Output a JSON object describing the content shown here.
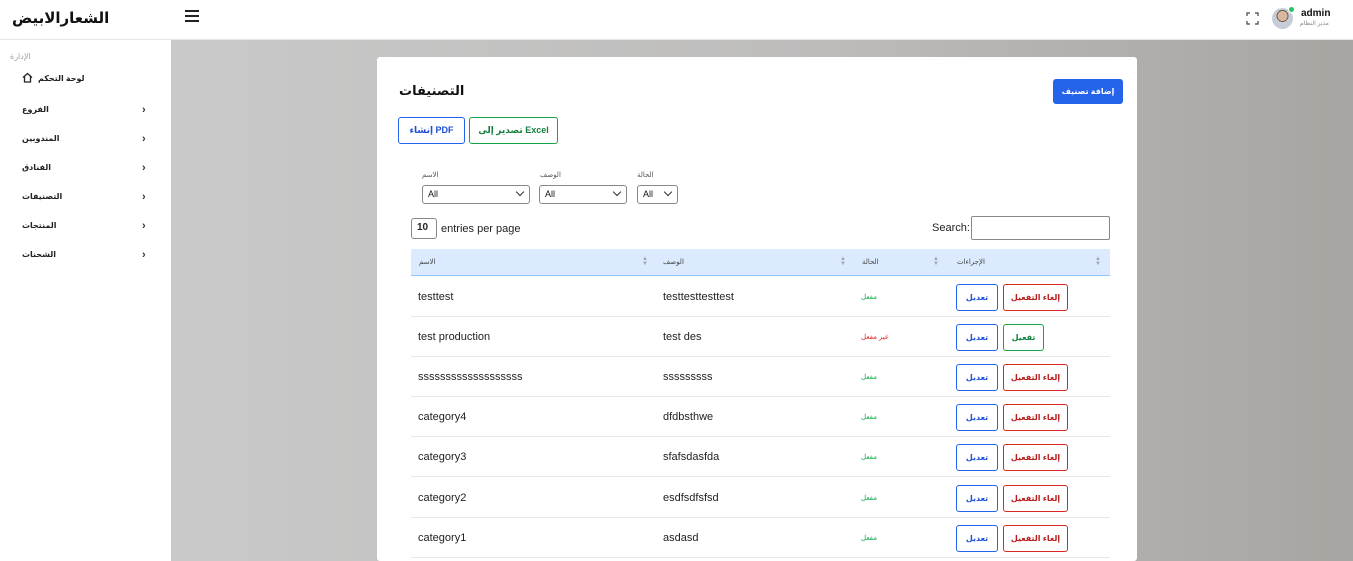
{
  "app": {
    "brand": "الشعارالابيض",
    "user_name": "admin",
    "user_role": "مدير النظام"
  },
  "sidebar": {
    "section_title": "الإدارة",
    "home_label": "لوحة التحكم",
    "items": [
      {
        "label": "الفروع"
      },
      {
        "label": "المندوبين"
      },
      {
        "label": "الفنادق"
      },
      {
        "label": "التصنيفات"
      },
      {
        "label": "المنتجات"
      },
      {
        "label": "الشحنات"
      }
    ]
  },
  "page": {
    "title": "التصنيفات",
    "add_button": "إضافة تصنيف",
    "pdf_button": "إنشاء PDF",
    "excel_button": "تصدير إلى Excel"
  },
  "filters": {
    "name_label": "الاسم",
    "desc_label": "الوصف",
    "status_label": "الحالة",
    "name_value": "All",
    "desc_value": "All",
    "status_value": "All"
  },
  "table_controls": {
    "entries_value": "10",
    "entries_label": "entries per page",
    "search_label": "Search:"
  },
  "table": {
    "headers": {
      "name": "الاسم",
      "desc": "الوصف",
      "status": "الحالة",
      "actions": "الإجراءات"
    },
    "edit_label": "تعديل",
    "rows": [
      {
        "name": "testtest",
        "desc": "testtesttesttest",
        "status": "مفعل",
        "action": "إلغاء التفعيل",
        "active": true
      },
      {
        "name": "test production",
        "desc": "test des",
        "status": "غير مفعل",
        "action": "تفعيل",
        "active": false
      },
      {
        "name": "sssssssssssssssssss",
        "desc": "sssssssss",
        "status": "مفعل",
        "action": "إلغاء التفعيل",
        "active": true
      },
      {
        "name": "category4",
        "desc": "dfdbsthwe",
        "status": "مفعل",
        "action": "إلغاء التفعيل",
        "active": true
      },
      {
        "name": "category3",
        "desc": "sfafsdasfda",
        "status": "مفعل",
        "action": "إلغاء التفعيل",
        "active": true
      },
      {
        "name": "category2",
        "desc": "esdfsdfsfsd",
        "status": "مفعل",
        "action": "إلغاء التفعيل",
        "active": true
      },
      {
        "name": "category1",
        "desc": "asdasd",
        "status": "مفعل",
        "action": "إلغاء التفعيل",
        "active": true
      }
    ]
  },
  "colors": {
    "primary": "#2563eb",
    "success": "#16a34a",
    "danger": "#dc2626",
    "table_header": "#dbeafe"
  }
}
